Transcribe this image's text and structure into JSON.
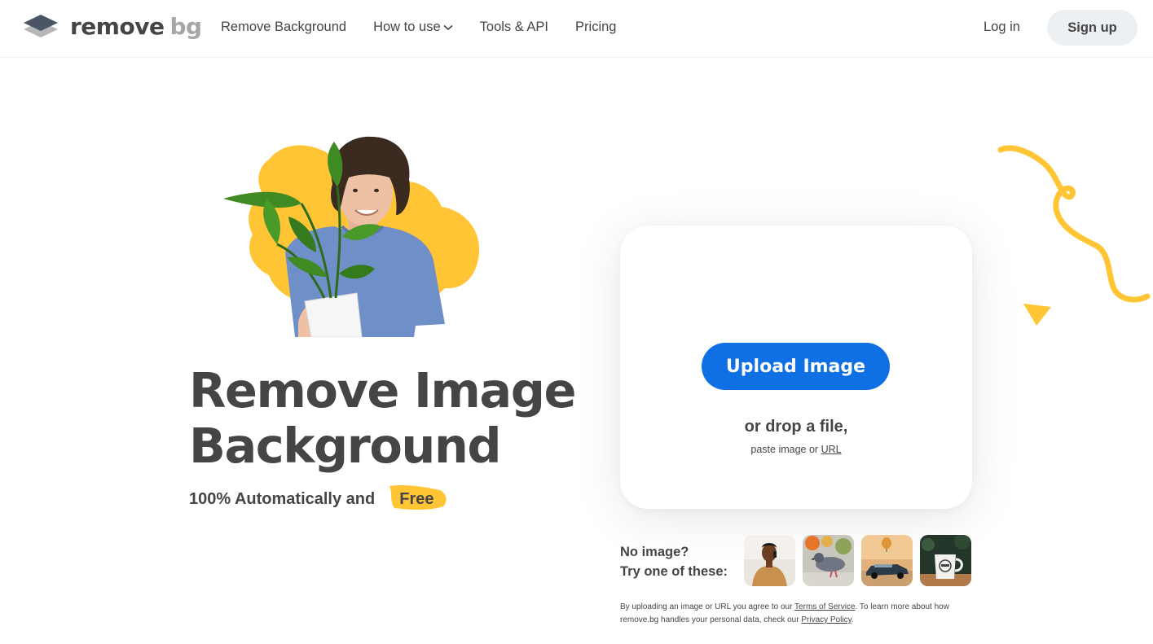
{
  "header": {
    "logo_word1": "remove",
    "logo_word2": "bg",
    "nav": [
      {
        "label": "Remove Background"
      },
      {
        "label": "How to use"
      },
      {
        "label": "Tools & API"
      },
      {
        "label": "Pricing"
      }
    ],
    "login_label": "Log in",
    "signup_label": "Sign up"
  },
  "hero": {
    "title_line1": "Remove Image",
    "title_line2": "Background",
    "subtitle": "100% Automatically and",
    "subtitle_highlight": "Free"
  },
  "upload": {
    "button_label": "Upload Image",
    "drop_text": "or drop a file,",
    "paste_text": "paste image or",
    "url_link": "URL"
  },
  "samples": {
    "line1": "No image?",
    "line2": "Try one of these:",
    "items": [
      "sample-person-photo",
      "sample-pigeon-photo",
      "sample-car-balloon-photo",
      "sample-mug-photo"
    ]
  },
  "legal": {
    "prefix": "By uploading an image or URL you agree to our",
    "terms_link": "Terms of Service",
    "middle": ". To learn more about how remove.bg handles your personal data, check our",
    "privacy_link": "Privacy Policy",
    "suffix": "."
  },
  "colors": {
    "accent_blue": "#0f70e6",
    "accent_yellow": "#ffc535",
    "text": "#454545",
    "signup_bg": "#edf0f3"
  }
}
